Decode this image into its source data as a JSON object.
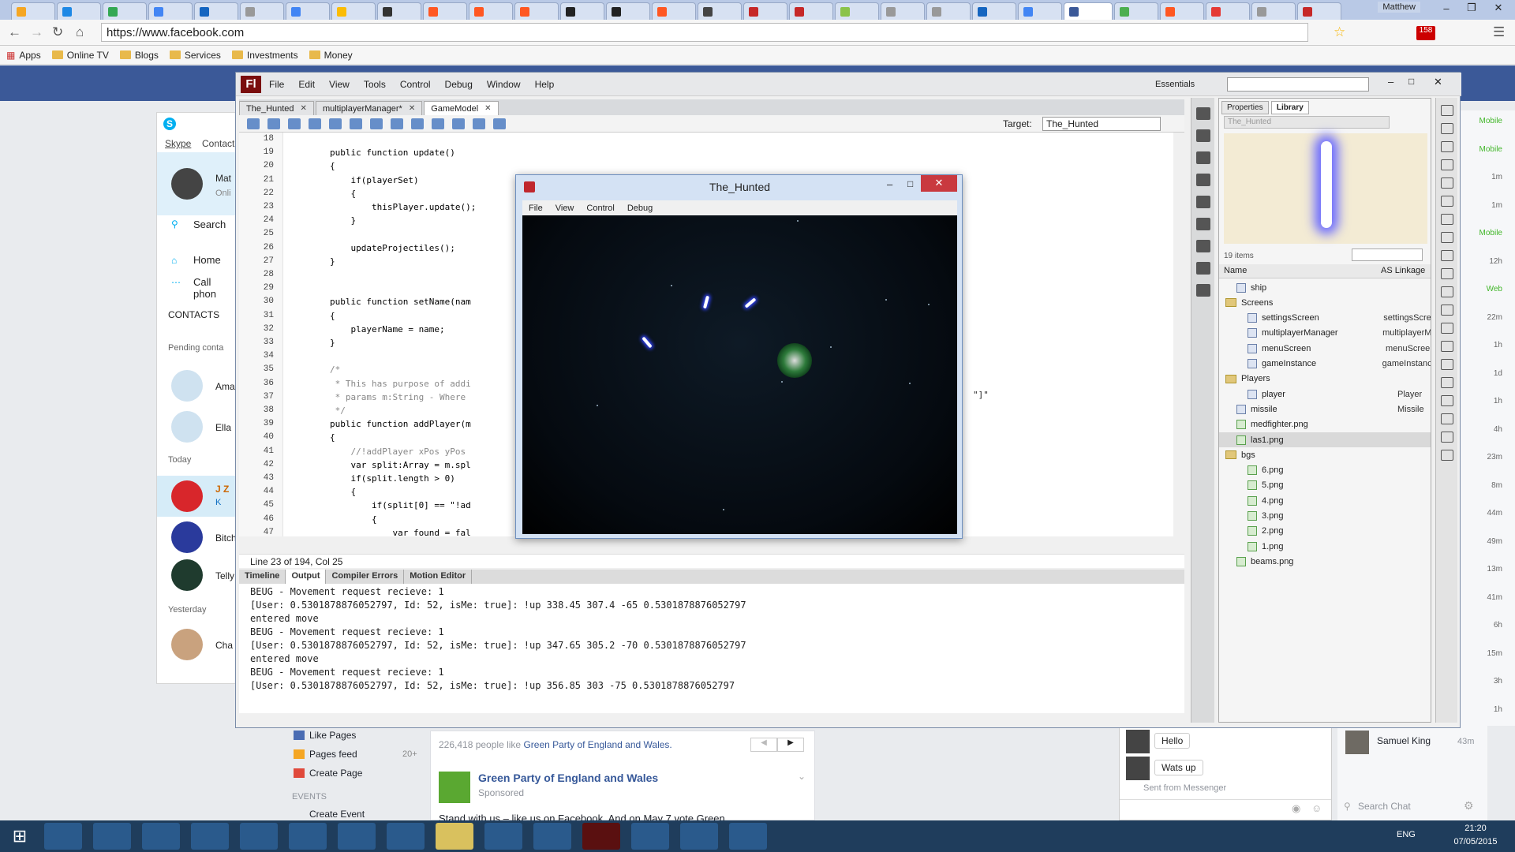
{
  "browser": {
    "user": "Matthew",
    "url": "https://www.facebook.com",
    "bookmarks": [
      "Apps",
      "Online TV",
      "Blogs",
      "Services",
      "Investments",
      "Money"
    ],
    "notification_count": "158"
  },
  "skype": {
    "brand": "S",
    "tabs": [
      "Skype",
      "Contact"
    ],
    "user_name": "Mat",
    "user_status": "Onli",
    "search": "Search",
    "home": "Home",
    "call": "Call phon",
    "contacts_header": "CONTACTS",
    "pending": "Pending conta",
    "contacts": [
      {
        "name": "Ama"
      },
      {
        "name": "Ella"
      },
      {
        "name": "J Z",
        "sub": "K"
      },
      {
        "name": "Bitch"
      },
      {
        "name": "Telly"
      },
      {
        "name": "Cha"
      }
    ],
    "today": "Today",
    "yesterday": "Yesterday"
  },
  "flash": {
    "menu": [
      "File",
      "Edit",
      "View",
      "Tools",
      "Control",
      "Debug",
      "Window",
      "Help"
    ],
    "workspace": "Essentials",
    "doc_tabs": [
      "The_Hunted",
      "multiplayerManager*",
      "GameModel"
    ],
    "target_label": "Target:",
    "target_value": "The_Hunted",
    "status_line": "Line 23 of 194, Col 25",
    "panel_tabs": [
      "Timeline",
      "Output",
      "Compiler Errors",
      "Motion Editor"
    ],
    "code": [
      {
        "n": "18",
        "t": ""
      },
      {
        "n": "19",
        "t": "        public function update()"
      },
      {
        "n": "20",
        "t": "        {"
      },
      {
        "n": "21",
        "t": "            if(playerSet)"
      },
      {
        "n": "22",
        "t": "            {"
      },
      {
        "n": "23",
        "t": "                thisPlayer.update();"
      },
      {
        "n": "24",
        "t": "            }"
      },
      {
        "n": "25",
        "t": ""
      },
      {
        "n": "26",
        "t": "            updateProjectiles();"
      },
      {
        "n": "27",
        "t": "        }"
      },
      {
        "n": "28",
        "t": ""
      },
      {
        "n": "29",
        "t": ""
      },
      {
        "n": "30",
        "t": "        public function setName(nam"
      },
      {
        "n": "31",
        "t": "        {"
      },
      {
        "n": "32",
        "t": "            playerName = name;"
      },
      {
        "n": "33",
        "t": "        }"
      },
      {
        "n": "34",
        "t": ""
      },
      {
        "n": "35",
        "t": "        /*"
      },
      {
        "n": "36",
        "t": "         * This has purpose of addi"
      },
      {
        "n": "37",
        "t": "         * params m:String - Where"
      },
      {
        "n": "38",
        "t": "         */"
      },
      {
        "n": "39",
        "t": "        public function addPlayer(m"
      },
      {
        "n": "40",
        "t": "        {"
      },
      {
        "n": "41",
        "t": "            //!addPlayer xPos yPos"
      },
      {
        "n": "42",
        "t": "            var split:Array = m.spl"
      },
      {
        "n": "43",
        "t": "            if(split.length > 0)"
      },
      {
        "n": "44",
        "t": "            {"
      },
      {
        "n": "45",
        "t": "                if(split[0] == \"!ad"
      },
      {
        "n": "46",
        "t": "                {"
      },
      {
        "n": "47",
        "t": "                    var found = fal"
      }
    ],
    "code_overflow": "\"]\"",
    "output": [
      "BEUG - Movement request recieve: 1",
      "[User: 0.5301878876052797, Id: 52, isMe: true]: !up 338.45 307.4 -65 0.5301878876052797",
      "entered move",
      "BEUG - Movement request recieve: 1",
      "[User: 0.5301878876052797, Id: 52, isMe: true]: !up 347.65 305.2 -70 0.5301878876052797",
      "entered move",
      "BEUG - Movement request recieve: 1",
      "[User: 0.5301878876052797, Id: 52, isMe: true]: !up 356.85 303 -75 0.5301878876052797"
    ]
  },
  "library": {
    "tabs": [
      "Properties",
      "Library"
    ],
    "doc": "The_Hunted",
    "count": "19 items",
    "col_name": "Name",
    "col_linkage": "AS Linkage",
    "items": [
      {
        "name": "ship",
        "linkage": "",
        "kind": "sym",
        "indent": 1
      },
      {
        "name": "Screens",
        "linkage": "",
        "kind": "folder",
        "indent": 0
      },
      {
        "name": "settingsScreen",
        "linkage": "settingsScree",
        "kind": "sym",
        "indent": 2
      },
      {
        "name": "multiplayerManager",
        "linkage": "multiplayerMa",
        "kind": "sym",
        "indent": 2
      },
      {
        "name": "menuScreen",
        "linkage": "menuScreen",
        "kind": "sym",
        "indent": 2
      },
      {
        "name": "gameInstance",
        "linkage": "gameInstance",
        "kind": "sym",
        "indent": 2
      },
      {
        "name": "Players",
        "linkage": "",
        "kind": "folder",
        "indent": 0
      },
      {
        "name": "player",
        "linkage": "Player",
        "kind": "sym",
        "indent": 2
      },
      {
        "name": "missile",
        "linkage": "Missile",
        "kind": "sym",
        "indent": 1
      },
      {
        "name": "medfighter.png",
        "linkage": "",
        "kind": "img",
        "indent": 1
      },
      {
        "name": "las1.png",
        "linkage": "",
        "kind": "img",
        "indent": 1
      },
      {
        "name": "bgs",
        "linkage": "",
        "kind": "folder",
        "indent": 0
      },
      {
        "name": "6.png",
        "linkage": "",
        "kind": "img",
        "indent": 2
      },
      {
        "name": "5.png",
        "linkage": "",
        "kind": "img",
        "indent": 2
      },
      {
        "name": "4.png",
        "linkage": "",
        "kind": "img",
        "indent": 2
      },
      {
        "name": "3.png",
        "linkage": "",
        "kind": "img",
        "indent": 2
      },
      {
        "name": "2.png",
        "linkage": "",
        "kind": "img",
        "indent": 2
      },
      {
        "name": "1.png",
        "linkage": "",
        "kind": "img",
        "indent": 2
      },
      {
        "name": "beams.png",
        "linkage": "",
        "kind": "img",
        "indent": 1
      }
    ]
  },
  "game": {
    "title": "The_Hunted",
    "menu": [
      "File",
      "View",
      "Control",
      "Debug"
    ]
  },
  "facebook": {
    "left_links": [
      "Like Pages",
      "Pages feed",
      "Create Page"
    ],
    "pages_feed_count": "20+",
    "events_header": "EVENTS",
    "create_event": "Create Event",
    "likes_text": "226,418 people like",
    "likes_page": "Green Party of England and Wales.",
    "sponsored_name": "Green Party of England and Wales",
    "sponsored_label": "Sponsored",
    "sponsored_text": "Stand with us – like us on Facebook. And on May 7 vote Green",
    "chat_messages": [
      "Hello",
      "Wats up"
    ],
    "sent_from": "Sent from Messenger",
    "search_chat": "Search Chat",
    "chat_contact": "Samuel King",
    "chat_time": "43m",
    "online_labels": [
      "Mobile",
      "Mobile",
      "1m",
      "1m",
      "Mobile",
      "12h",
      "Web",
      "22m",
      "1h",
      "1d",
      "1h",
      "4h",
      "23m",
      "8m",
      "44m",
      "49m",
      "13m",
      "41m",
      "6h",
      "15m",
      "3h",
      "1h"
    ]
  },
  "taskbar": {
    "time": "21:20",
    "date": "07/05/2015",
    "lang": "ENG"
  }
}
